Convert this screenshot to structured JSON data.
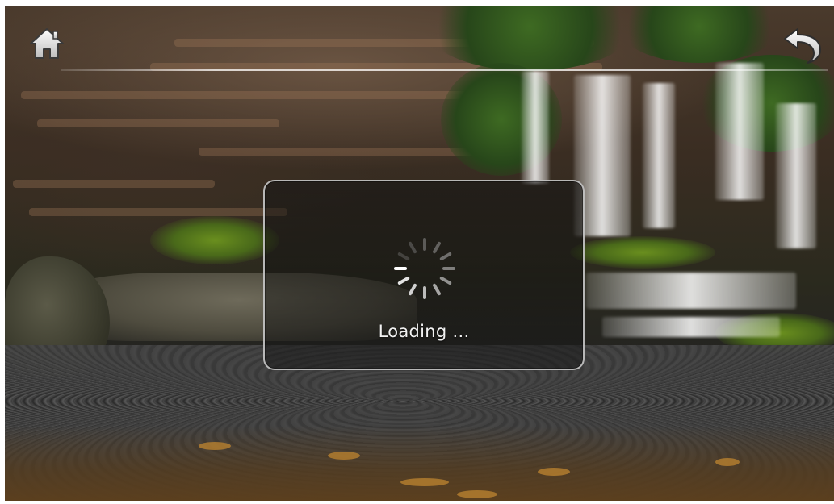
{
  "topbar": {
    "home_icon": "home-icon",
    "back_icon": "back-arrow-icon"
  },
  "dialog": {
    "loading_text": "Loading ...",
    "spinner_icon": "loading-spinner-icon"
  },
  "colors": {
    "dialog_border": "#d2d2d2",
    "text": "#f2f2f2",
    "spinner_active": "#ffffff",
    "spinner_dim": "#a0a0a0"
  }
}
